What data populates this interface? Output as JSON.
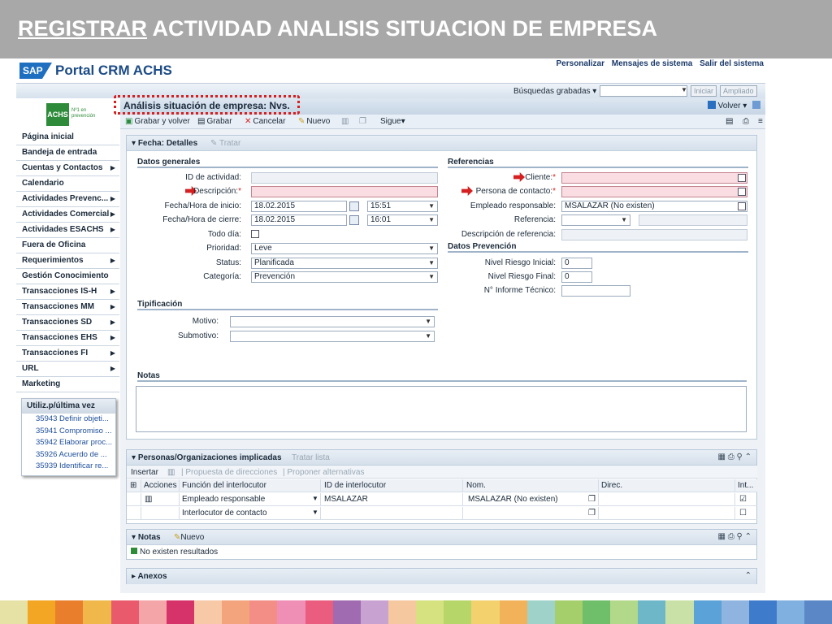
{
  "slide": {
    "title_underlined": "REGISTRAR",
    "title_rest": " ACTIVIDAD ANALISIS SITUACION DE EMPRESA"
  },
  "portal": {
    "logo": "SAP",
    "name": "Portal CRM ACHS",
    "links": [
      "Personalizar",
      "Mensajes de sistema",
      "Salir del sistema"
    ],
    "saved_searches_label": "Búsquedas grabadas",
    "start_button": "Iniciar",
    "extended_button": "Ampliado"
  },
  "brand": {
    "achs": "ACHS",
    "tagline_1": "Nº1 en",
    "tagline_2": "prevención"
  },
  "nav": {
    "items": [
      {
        "label": "Página inicial",
        "arrow": ""
      },
      {
        "label": "Bandeja de entrada",
        "arrow": ""
      },
      {
        "label": "Cuentas y Contactos",
        "arrow": "▶"
      },
      {
        "label": "Calendario",
        "arrow": ""
      },
      {
        "label": "Actividades Prevenc...",
        "arrow": "▶"
      },
      {
        "label": "Actividades Comercial",
        "arrow": "▶"
      },
      {
        "label": "Actividades ESACHS",
        "arrow": "▶"
      },
      {
        "label": "Fuera de Oficina",
        "arrow": ""
      },
      {
        "label": "Requerimientos",
        "arrow": "▶"
      },
      {
        "label": "Gestión Conocimiento",
        "arrow": ""
      },
      {
        "label": "Transacciones IS-H",
        "arrow": "▶"
      },
      {
        "label": "Transacciones MM",
        "arrow": "▶"
      },
      {
        "label": "Transacciones SD",
        "arrow": "▶"
      },
      {
        "label": "Transacciones EHS",
        "arrow": "▶"
      },
      {
        "label": "Transacciones FI",
        "arrow": "▶"
      },
      {
        "label": "URL",
        "arrow": "▶"
      },
      {
        "label": "Marketing",
        "arrow": ""
      }
    ]
  },
  "recent": {
    "title": "Utiliz.p/última vez",
    "items": [
      "35943 Definir objeti...",
      "35941 Compromiso ...",
      "35942 Elaborar proc...",
      "35926 Acuerdo de ...",
      "35939 Identificar re..."
    ]
  },
  "page": {
    "title": "Análisis situación de empresa: Nvs.",
    "back": "Volver"
  },
  "toolbar": {
    "save_back": "Grabar y volver",
    "save": "Grabar",
    "cancel": "Cancelar",
    "new": "Nuevo",
    "next": "Sigue"
  },
  "details": {
    "header": "Fecha: Detalles",
    "edit": "Tratar",
    "general_title": "Datos generales",
    "labels": {
      "activity_id": "ID de actividad:",
      "description": "Descripción:",
      "start": "Fecha/Hora de inicio:",
      "end": "Fecha/Hora de cierre:",
      "all_day": "Todo día:",
      "priority": "Prioridad:",
      "status": "Status:",
      "category": "Categoría:"
    },
    "values": {
      "start_date": "18.02.2015",
      "start_time": "15:51",
      "end_date": "18.02.2015",
      "end_time": "16:01",
      "priority": "Leve",
      "status": "Planificada",
      "category": "Prevención"
    },
    "refs_title": "Referencias",
    "ref_labels": {
      "client": "Cliente:",
      "contact": "Persona de contacto:",
      "employee": "Empleado responsable:",
      "reference": "Referencia:",
      "reference_desc": "Descripción de referencia:"
    },
    "ref_values": {
      "employee": "MSALAZAR (No existen)"
    },
    "prev_title": "Datos Prevención",
    "prev_labels": {
      "risk_initial": "Nivel Riesgo Inicial:",
      "risk_final": "Nivel Riesgo Final:",
      "tech_report": "N° Informe Técnico:"
    },
    "prev_values": {
      "risk_initial": "0",
      "risk_final": "0"
    },
    "typing_title": "Tipificación",
    "typing_labels": {
      "reason": "Motivo:",
      "subreason": "Submotivo:"
    },
    "notes_title": "Notas"
  },
  "parties": {
    "header": "Personas/Organizaciones implicadas",
    "edit_list": "Tratar lista",
    "insert": "Insertar",
    "suggest_addr": "Propuesta de direcciones",
    "suggest_alt": "Proponer alternativas",
    "columns": [
      "Acciones",
      "Función del interlocutor",
      "ID de interlocutor",
      "Nom.",
      "Direc.",
      "Int..."
    ],
    "rows": [
      {
        "function": "Empleado responsable",
        "id": "MSALAZAR",
        "name": "MSALAZAR (No existen)",
        "checked": true
      },
      {
        "function": "Interlocutor de contacto",
        "id": "",
        "name": "",
        "checked": false
      }
    ]
  },
  "notes_block": {
    "header": "Notas",
    "new": "Nuevo",
    "empty": "No existen resultados"
  },
  "attachments": {
    "header": "Anexos"
  },
  "colors": {
    "stripe": [
      "#e6e2a6",
      "#f2a623",
      "#e97f2c",
      "#f0b84a",
      "#e85a6c",
      "#f4a5a8",
      "#d6336a",
      "#f7c9a6",
      "#f3a47c",
      "#f28e86",
      "#ef8fb6",
      "#ea5d7e",
      "#a06bb0",
      "#c8a2d1",
      "#f6c89f",
      "#d5e27f",
      "#b6d66a",
      "#f3d26e",
      "#f2b25a",
      "#9fd2c9",
      "#a5cf6a",
      "#6fbf6a",
      "#b2d98a",
      "#6db7c9",
      "#c9e1a6",
      "#5aa2d8",
      "#8fb4df",
      "#3e7ccb",
      "#7fb0e0",
      "#5b87c7"
    ]
  }
}
